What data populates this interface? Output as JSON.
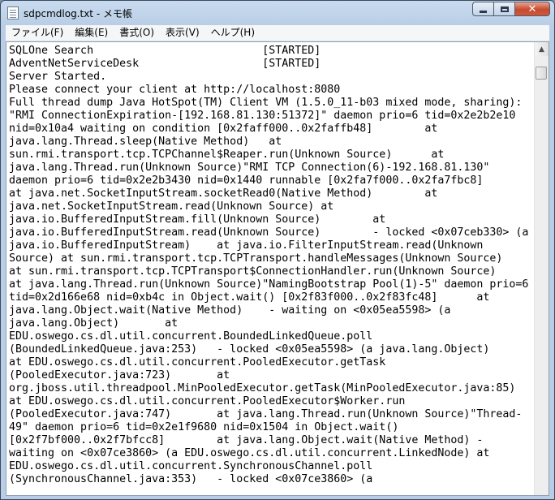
{
  "window": {
    "title": "sdpcmdlog.txt - メモ帳",
    "caption": {
      "minimize": "",
      "maximize": "",
      "close": "✕"
    }
  },
  "menu": [
    "ファイル(F)",
    "編集(E)",
    "書式(O)",
    "表示(V)",
    "ヘルプ(H)"
  ],
  "document": {
    "lines": [
      "SQLOne Search                          [STARTED]",
      "AdventNetServiceDesk                   [STARTED]",
      "Server Started.",
      "Please connect your client at http://localhost:8080",
      "Full thread dump Java HotSpot(TM) Client VM (1.5.0_11-b03 mixed mode, sharing):",
      "\"RMI ConnectionExpiration-[192.168.81.130:51372]\" daemon prio=6 tid=0x2e2b2e10",
      "nid=0x10a4 waiting on condition [0x2faff000..0x2faffb48]        at",
      "java.lang.Thread.sleep(Native Method)   at",
      "sun.rmi.transport.tcp.TCPChannel$Reaper.run(Unknown Source)      at",
      "java.lang.Thread.run(Unknown Source)\"RMI TCP Connection(6)-192.168.81.130\"",
      "daemon prio=6 tid=0x2e2b3430 nid=0x1440 runnable [0x2fa7f000..0x2fa7fbc8]",
      "at java.net.SocketInputStream.socketRead0(Native Method)        at",
      "java.net.SocketInputStream.read(Unknown Source) at",
      "java.io.BufferedInputStream.fill(Unknown Source)        at",
      "java.io.BufferedInputStream.read(Unknown Source)        - locked <0x07ceb330> (a",
      "java.io.BufferedInputStream)    at java.io.FilterInputStream.read(Unknown",
      "Source) at sun.rmi.transport.tcp.TCPTransport.handleMessages(Unknown Source)",
      "at sun.rmi.transport.tcp.TCPTransport$ConnectionHandler.run(Unknown Source)",
      "at java.lang.Thread.run(Unknown Source)\"NamingBootstrap Pool(1)-5\" daemon prio=6",
      "tid=0x2d166e68 nid=0xb4c in Object.wait() [0x2f83f000..0x2f83fc48]      at",
      "java.lang.Object.wait(Native Method)    - waiting on <0x05ea5598> (a",
      "java.lang.Object)       at",
      "EDU.oswego.cs.dl.util.concurrent.BoundedLinkedQueue.poll",
      "(BoundedLinkedQueue.java:253)   - locked <0x05ea5598> (a java.lang.Object)",
      "at EDU.oswego.cs.dl.util.concurrent.PooledExecutor.getTask",
      "(PooledExecutor.java:723)       at",
      "org.jboss.util.threadpool.MinPooledExecutor.getTask(MinPooledExecutor.java:85)",
      "at EDU.oswego.cs.dl.util.concurrent.PooledExecutor$Worker.run",
      "(PooledExecutor.java:747)       at java.lang.Thread.run(Unknown Source)\"Thread-",
      "49\" daemon prio=6 tid=0x2e1f9680 nid=0x1504 in Object.wait()",
      "[0x2f7bf000..0x2f7bfcc8]        at java.lang.Object.wait(Native Method) -",
      "waiting on <0x07ce3860> (a EDU.oswego.cs.dl.util.concurrent.LinkedNode) at",
      "EDU.oswego.cs.dl.util.concurrent.SynchronousChannel.poll",
      "(SynchronousChannel.java:353)   - locked <0x07ce3860> (a"
    ]
  },
  "scrollbar": {
    "up_arrow": "▲"
  }
}
